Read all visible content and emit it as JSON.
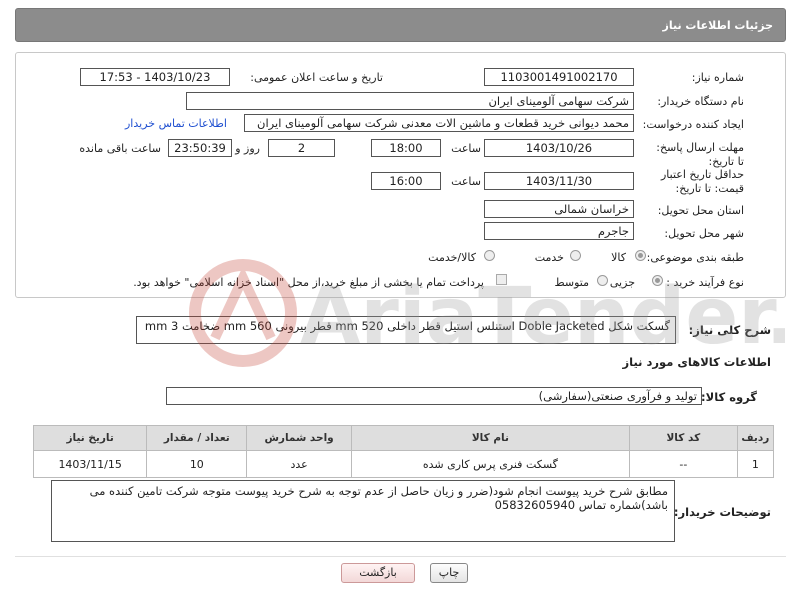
{
  "header": {
    "title": "جزئیات اطلاعات نیاز"
  },
  "need": {
    "number_label": "شماره نیاز:",
    "number": "1103001491002170",
    "announce_label": "تاریخ و ساعت اعلان عمومی:",
    "announce": "1403/10/23 - 17:53",
    "buyer_label": "نام دستگاه خریدار:",
    "buyer": "شرکت سهامی آلومینای ایران",
    "creator_label": "ایجاد کننده درخواست:",
    "creator": "محمد دیوانی خرید قطعات و ماشین الات معدنی شرکت سهامی آلومینای ایران",
    "contact_link": "اطلاعات تماس خریدار",
    "deadline_label": "مهلت ارسال پاسخ: تا تاریخ:",
    "deadline_date": "1403/10/26",
    "time_word": "ساعت",
    "deadline_time": "18:00",
    "days": "2",
    "days_and": "روز و",
    "remaining": "23:50:39",
    "remaining_label": "ساعت باقی مانده",
    "validity_label": "حداقل تاریخ اعتبار قیمت: تا تاریخ:",
    "validity_date": "1403/11/30",
    "validity_time": "16:00",
    "province_label": "استان محل تحویل:",
    "province": "خراسان شمالی",
    "city_label": "شهر محل تحویل:",
    "city": "جاجرم",
    "category_label": "طبقه بندی موضوعی:",
    "category_options": [
      "کالا",
      "خدمت",
      "کالا/خدمت"
    ],
    "process_label": "نوع فرآیند خرید :",
    "process_options": [
      "جزیی",
      "متوسط"
    ],
    "payment_text": "پرداخت تمام یا بخشی از مبلغ خرید،از محل \"اسناد خزانه اسلامی\" خواهد بود."
  },
  "description": {
    "label": "شرح کلی نیاز:",
    "text": "گسکت شکل Doble Jacketed استنلس استیل قطر داخلی 520 mm قطر بیرونی 560 mm ضخامت 3 mm"
  },
  "goods": {
    "section_title": "اطلاعات کالاهای مورد نیاز",
    "group_label": "گروه کالا:",
    "group": "تولید و فرآوری صنعتی(سفارشی)",
    "columns": [
      "ردیف",
      "کد کالا",
      "نام کالا",
      "واحد شمارش",
      "تعداد / مقدار",
      "تاریخ نیاز"
    ],
    "rows": [
      {
        "row": "1",
        "code": "--",
        "name": "گسکت فنری پرس کاری شده",
        "unit": "عدد",
        "qty": "10",
        "date": "1403/11/15"
      }
    ]
  },
  "buyer_notes": {
    "label": "توضیحات خریدار:",
    "text": "مطابق شرح خرید پیوست انجام شود(ضرر و زیان حاصل از عدم توجه به شرح خرید پیوست متوجه شرکت تامین کننده می باشد)شماره تماس 05832605940"
  },
  "buttons": {
    "print": "چاپ",
    "back": "بازگشت"
  },
  "watermark": {
    "text": "AriaTender.neT"
  }
}
